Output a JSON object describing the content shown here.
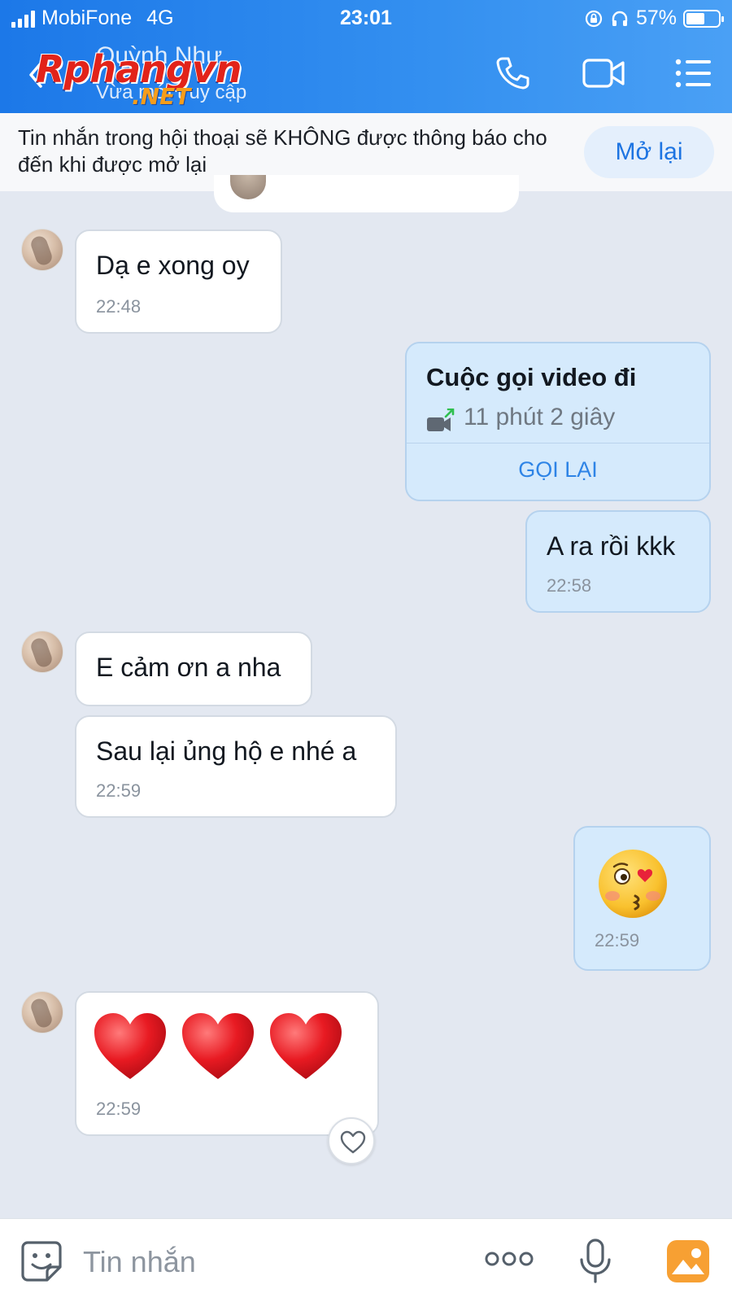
{
  "status_bar": {
    "carrier": "MobiFone",
    "network": "4G",
    "time": "23:01",
    "battery": "57%"
  },
  "header": {
    "contact_name": "Quỳnh Như",
    "contact_status": "Vừa mới truy cập",
    "watermark_main": "Rphangvn",
    "watermark_sub": ".NET",
    "icons": [
      "back-icon",
      "phone-icon",
      "video-camera-icon",
      "menu-list-icon"
    ]
  },
  "mute_banner": {
    "text": "Tin nhắn trong hội thoại sẽ KHÔNG được thông báo cho đến khi được mở lại",
    "button": "Mở lại"
  },
  "messages": {
    "m1": {
      "text": "Dạ e xong oy",
      "time": "22:48"
    },
    "call": {
      "title": "Cuộc gọi video đi",
      "duration": "11 phút 2 giây",
      "action": "GỌI LẠI"
    },
    "m2": {
      "text": "A ra rồi kkk",
      "time": "22:58"
    },
    "m3": {
      "text": "E cảm ơn a nha"
    },
    "m4": {
      "text": "Sau lại ủng hộ e nhé a",
      "time": "22:59"
    },
    "m5": {
      "sticker": "kissing-face-emoji",
      "time": "22:59"
    },
    "m6": {
      "content": "three-red-hearts-emoji",
      "time": "22:59"
    }
  },
  "input_bar": {
    "placeholder": "Tin nhắn",
    "icons": [
      "sticker-icon",
      "more-icon",
      "microphone-icon",
      "gallery-icon"
    ]
  },
  "colors": {
    "header_start": "#1c78e8",
    "header_end": "#4aa0f5",
    "accent": "#1d74e2",
    "chat_background": "#e3e8f1",
    "outgoing_bubble": "#d5eafc",
    "incoming_bubble": "#ffffff"
  }
}
